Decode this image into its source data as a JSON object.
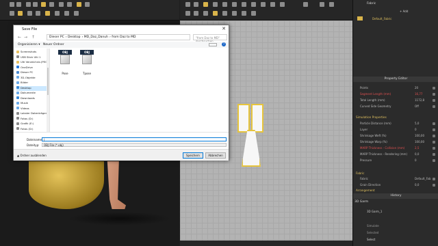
{
  "dialog": {
    "title": "Save File",
    "close": "✕",
    "address": [
      "Dieser PC",
      "Desktop",
      "MD_Daz_Danuh",
      "from Daz to MD"
    ],
    "search_placeholder": "\"from Daz to MD\" durchsuchen",
    "organize": "Organisieren ▾",
    "new_folder": "Neuer Ordner",
    "nav_items": [
      {
        "label": "Screenshots",
        "color": "#e8c060"
      },
      {
        "label": "USB Stick Ulti 1",
        "color": "#888888"
      },
      {
        "label": "Ulti Verzeichnis JPEG",
        "color": "#e8c060"
      },
      {
        "label": "OneDrive",
        "color": "#2a7ad8"
      },
      {
        "label": "Dieser PC",
        "color": "#4a8ad0"
      },
      {
        "label": "3D-Objekte",
        "color": "#6aaae8"
      },
      {
        "label": "Bilder",
        "color": "#6aaae8"
      },
      {
        "label": "Desktop",
        "color": "#3a8ad8"
      },
      {
        "label": "Dokumente",
        "color": "#6aaae8"
      },
      {
        "label": "Downloads",
        "color": "#3a8ad8"
      },
      {
        "label": "Musik",
        "color": "#6aaae8"
      },
      {
        "label": "Videos",
        "color": "#6aaae8"
      },
      {
        "label": "Lokaler Datenträger",
        "color": "#888888"
      },
      {
        "label": "Fotos (D:)",
        "color": "#888888"
      },
      {
        "label": "Grafik (E:)",
        "color": "#888888"
      },
      {
        "label": "Fotos (D:)",
        "color": "#888888"
      }
    ],
    "files": [
      {
        "tag": "OBJ",
        "name": "Pose"
      },
      {
        "tag": "OBJ",
        "name": "Tpose"
      }
    ],
    "filename_label": "Dateiname:",
    "filename_value": "|",
    "filetype_label": "Dateityp:",
    "filetype_value": "OBJ File (*.obj)",
    "hide_folders": "▲ Ordner ausblenden",
    "save": "Speichern",
    "cancel": "Abbrechen"
  },
  "right_panel": {
    "fabric_tab": "Fabric",
    "add": "+ Add",
    "fabric_item": "Default_Fabric",
    "property_editor": "Property Editor",
    "rows": [
      {
        "label": "Points",
        "value": "20",
        "red": false
      },
      {
        "label": "Segment Length (mm)",
        "value": "16,77",
        "red": true
      },
      {
        "label": "Total Length (mm)",
        "value": "1172,8",
        "red": false
      },
      {
        "label": "Curved Side Geometry",
        "value": "Off",
        "red": false
      }
    ],
    "sim_section": "Simulation Properties",
    "sim_rows": [
      {
        "label": "Particle Distance (mm)",
        "value": "5,0",
        "red": false
      },
      {
        "label": "Layer",
        "value": "0",
        "red": false
      },
      {
        "label": "Shrinkage Weft (%)",
        "value": "100,00",
        "red": false
      },
      {
        "label": "Shrinkage Warp (%)",
        "value": "100,00",
        "red": false
      },
      {
        "label": "MARP Thickness - Collision (mm)",
        "value": "2,5",
        "red": true
      },
      {
        "label": "MARP Thickness - Rendering (mm)",
        "value": "0,0",
        "red": false
      },
      {
        "label": "Pressure",
        "value": "0",
        "red": false
      }
    ],
    "fabric_section": "Fabric",
    "fabric_rows": [
      {
        "label": "Fabric",
        "value": "Default_Fab",
        "red": false
      },
      {
        "label": "Grain Direction",
        "value": "0,0",
        "red": false
      }
    ],
    "arrangement": "Arrangement",
    "history": "History",
    "object_browser": "3D Garm",
    "garm_item": "3D Garm_1",
    "bottom_items": [
      "Simulate",
      "Selected",
      "Select"
    ]
  },
  "colors": {
    "accent": "#e6c43c",
    "red": "#e05050",
    "panel": "#2b2b2b"
  }
}
